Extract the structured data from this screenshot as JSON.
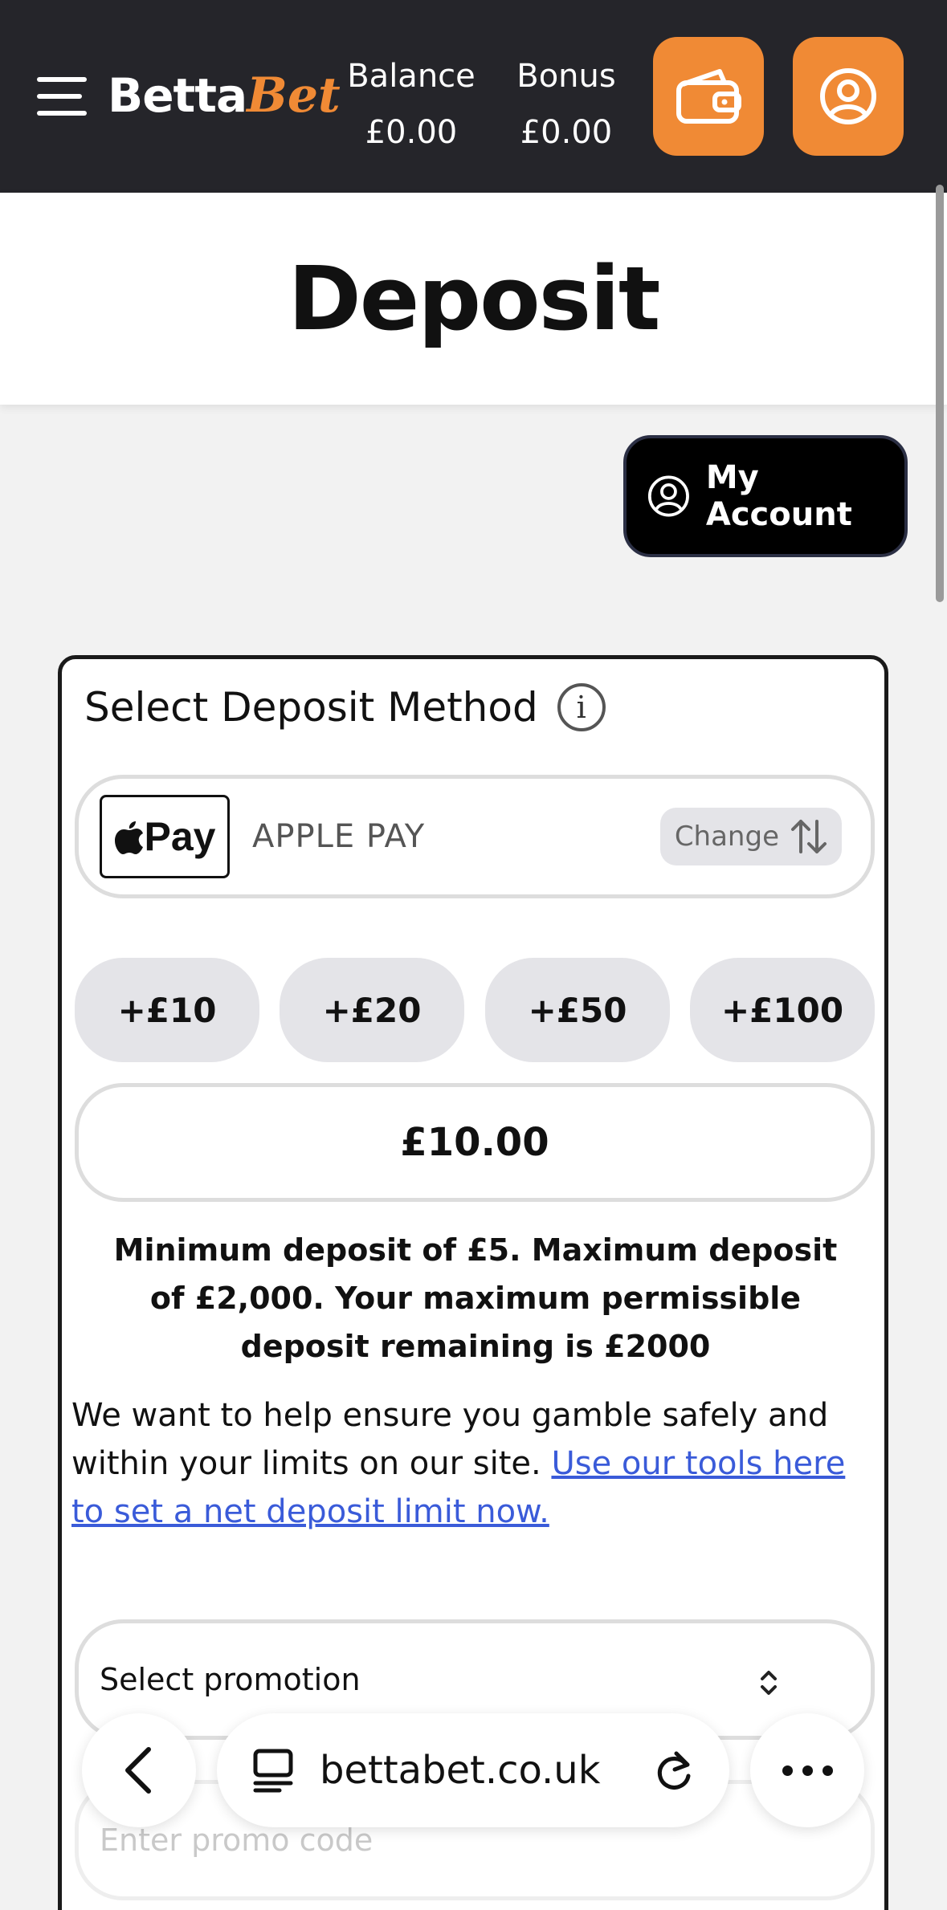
{
  "header": {
    "logo_part1": "Betta",
    "logo_part2": "Bet",
    "balance_label": "Balance",
    "balance_value": "£0.00",
    "bonus_label": "Bonus",
    "bonus_value": "£0.00",
    "accent_color": "#f08a35"
  },
  "page": {
    "title": "Deposit"
  },
  "my_account_label": "My Account",
  "deposit": {
    "section_title": "Select Deposit Method",
    "method_badge": "Pay",
    "method_name": "APPLE PAY",
    "change_label": "Change",
    "quick_amounts": [
      "+£10",
      "+£20",
      "+£50",
      "+£100"
    ],
    "amount_value": "£10.00",
    "limits_text": "Minimum deposit of £5. Maximum deposit of £2,000. Your maximum permissible deposit remaining is £2000",
    "safe_text": "We want to help ensure you gamble safely and within your limits on our site. ",
    "safe_link": "Use our tools here to set a net deposit limit now.",
    "promotion_placeholder": "Select promotion",
    "promo_code_placeholder": "Enter promo code"
  },
  "browser": {
    "url": "bettabet.co.uk"
  }
}
